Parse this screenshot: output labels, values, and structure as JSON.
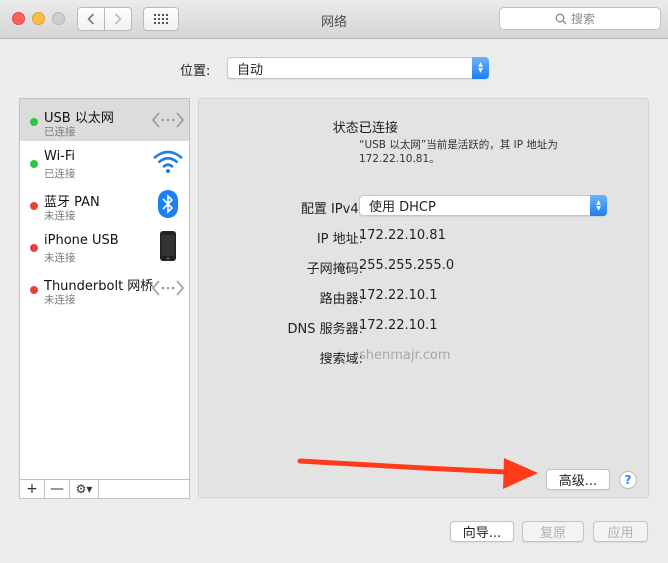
{
  "window": {
    "title": "网络",
    "search_placeholder": "搜索"
  },
  "location": {
    "label": "位置:",
    "value": "自动"
  },
  "services": [
    {
      "name": "USB 以太网",
      "status": "已连接",
      "status_color": "#2dc63f",
      "icon": "ethernet-icon",
      "selected": true
    },
    {
      "name": "Wi-Fi",
      "status": "已连接",
      "status_color": "#2dc63f",
      "icon": "wifi-icon",
      "selected": false
    },
    {
      "name": "蓝牙 PAN",
      "status": "未连接",
      "status_color": "#e8403a",
      "icon": "bluetooth-icon",
      "selected": false
    },
    {
      "name": "iPhone USB",
      "status": "未连接",
      "status_color": "#e8403a",
      "icon": "iphone-icon",
      "selected": false
    },
    {
      "name": "Thunderbolt 网桥",
      "status": "未连接",
      "status_color": "#e8403a",
      "icon": "ethernet-icon",
      "selected": false
    }
  ],
  "list_toolbar": {
    "add": "+",
    "remove": "—",
    "gear": "⚙▾"
  },
  "detail": {
    "status_label": "状态:",
    "status_value": "已连接",
    "status_desc": "“USB 以太网”当前是活跃的，其 IP 地址为 172.22.10.81。",
    "ipv4_label": "配置 IPv4:",
    "ipv4_value": "使用 DHCP",
    "ip_label": "IP 地址:",
    "ip_value": "172.22.10.81",
    "subnet_label": "子网掩码:",
    "subnet_value": "255.255.255.0",
    "router_label": "路由器:",
    "router_value": "172.22.10.1",
    "dns_label": "DNS 服务器:",
    "dns_value": "172.22.10.1",
    "search_domain_label": "搜索域:",
    "search_domain_value": "shenmajr.com",
    "advanced_button": "高级...",
    "help": "?"
  },
  "footer": {
    "assistant": "向导...",
    "revert": "复原",
    "apply": "应用"
  },
  "colors": {
    "accent": "#197ff2",
    "annotation_arrow": "#ff3b1a"
  }
}
